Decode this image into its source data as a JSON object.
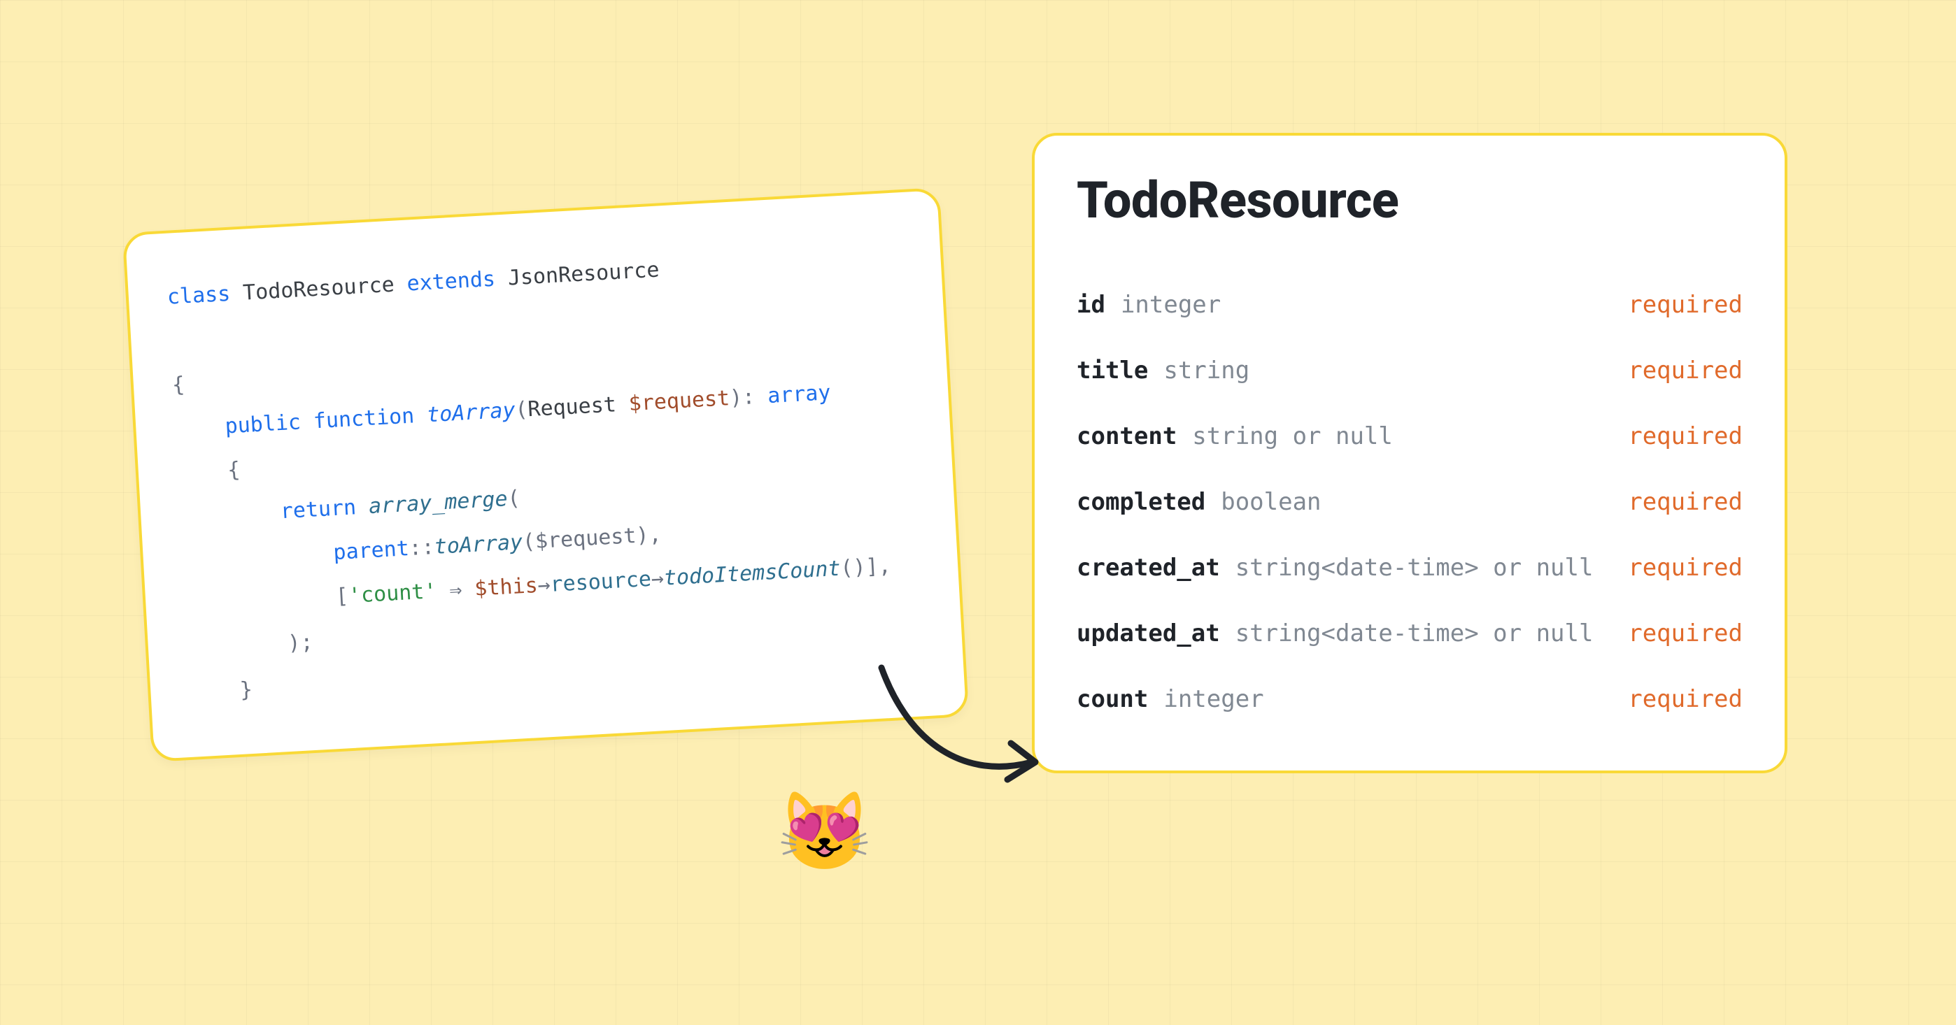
{
  "emoji": "😻",
  "code": {
    "kw_class": "class",
    "cls_name": "TodoResource",
    "kw_extends": "extends",
    "cls_parent": "JsonResource",
    "brace_open": "{",
    "kw_public": "public",
    "kw_function": "function",
    "fn_toArray": "toArray",
    "paren_open": "(",
    "cls_request": "Request",
    "var_request": "$request",
    "paren_close_colon": "):",
    "ret_type": "array",
    "brace_open2": "{",
    "kw_return": "return",
    "fn_array_merge": "array_merge",
    "paren_open2": "(",
    "kw_parent": "parent",
    "dbl_colon": "::",
    "call_toArray": "toArray",
    "args_request": "($request),",
    "bracket_open": "[",
    "str_count": "'count'",
    "arrow_fat": " ⇒ ",
    "var_this": "$this",
    "arrow_thin1": "→",
    "prop_resource": "resource",
    "arrow_thin2": "→",
    "call_todoItemsCount": "todoItemsCount",
    "call_close": "()],",
    "paren_close2": ");",
    "brace_close2": "}",
    "brace_close": "}"
  },
  "schema": {
    "title": "TodoResource",
    "required_label": "required",
    "fields": [
      {
        "name": "id",
        "type": "integer"
      },
      {
        "name": "title",
        "type": "string"
      },
      {
        "name": "content",
        "type": "string or null"
      },
      {
        "name": "completed",
        "type": "boolean"
      },
      {
        "name": "created_at",
        "type": "string<date-time> or null"
      },
      {
        "name": "updated_at",
        "type": "string<date-time> or null"
      },
      {
        "name": "count",
        "type": "integer"
      }
    ]
  }
}
